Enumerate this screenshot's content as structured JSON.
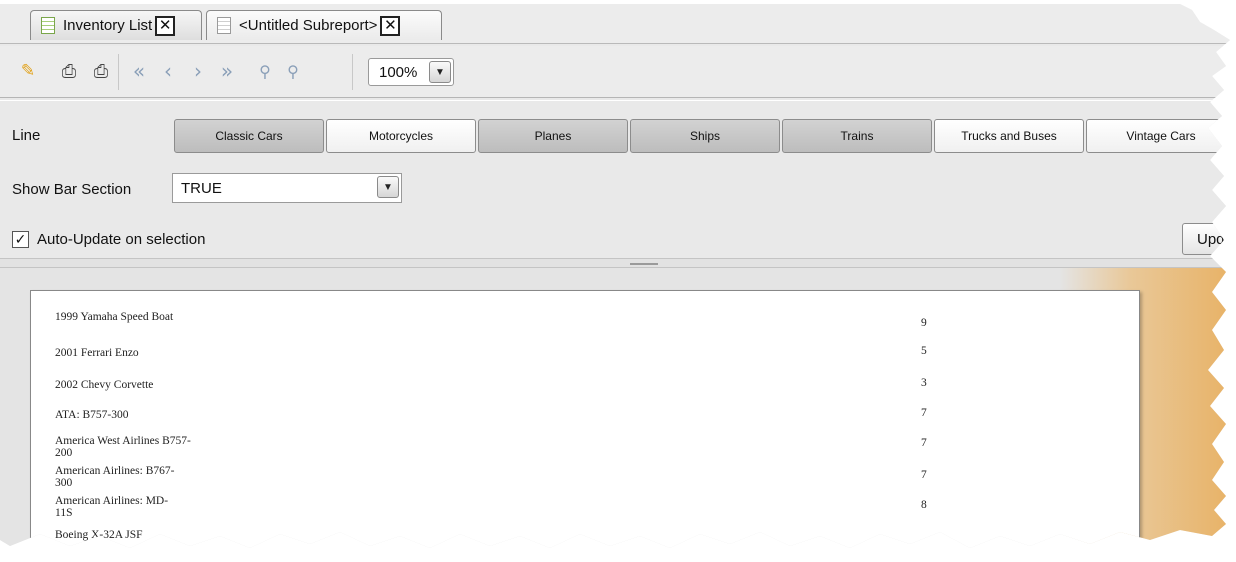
{
  "tabs": [
    {
      "label": "Inventory List",
      "close": "✕"
    },
    {
      "label": "<Untitled Subreport>",
      "close": "✕"
    }
  ],
  "toolbar": {
    "zoom_value": "100%",
    "dropdown_arrow": "▼",
    "icons": [
      "pencil-icon",
      "print-icon",
      "print-alt-icon",
      "first-page-icon",
      "prev-page-icon",
      "next-page-icon",
      "last-page-icon",
      "zoom-out-icon",
      "zoom-in-icon"
    ]
  },
  "params": {
    "line_label": "Line",
    "line_options": [
      {
        "label": "Classic Cars",
        "selected": true
      },
      {
        "label": "Motorcycles",
        "selected": false
      },
      {
        "label": "Planes",
        "selected": true
      },
      {
        "label": "Ships",
        "selected": true
      },
      {
        "label": "Trains",
        "selected": true
      },
      {
        "label": "Trucks and Buses",
        "selected": false
      },
      {
        "label": "Vintage Cars",
        "selected": false
      }
    ],
    "show_bar_label": "Show Bar Section",
    "show_bar_value": "TRUE",
    "auto_update_label": "Auto-Update on selection",
    "auto_update_checked": true,
    "update_button_label": "Update"
  },
  "report": {
    "rows": [
      {
        "name": "1999 Yamaha Speed Boat",
        "qty": "9"
      },
      {
        "name": "2001 Ferrari Enzo",
        "qty": "5"
      },
      {
        "name": "2002 Chevy Corvette",
        "qty": "3"
      },
      {
        "name": "ATA: B757-300",
        "qty": "7"
      },
      {
        "name": "America West Airlines B757-200",
        "qty": "7"
      },
      {
        "name": "American Airlines: B767-300",
        "qty": "7"
      },
      {
        "name": "American Airlines: MD-11S",
        "qty": "8"
      },
      {
        "name": "Boeing X-32A JSF",
        "qty": ""
      }
    ]
  },
  "colors": {
    "panel_bg": "#e9e9e9",
    "selected_tab_bg": "#c8c8c8",
    "preview_accent": "#e8b164"
  }
}
